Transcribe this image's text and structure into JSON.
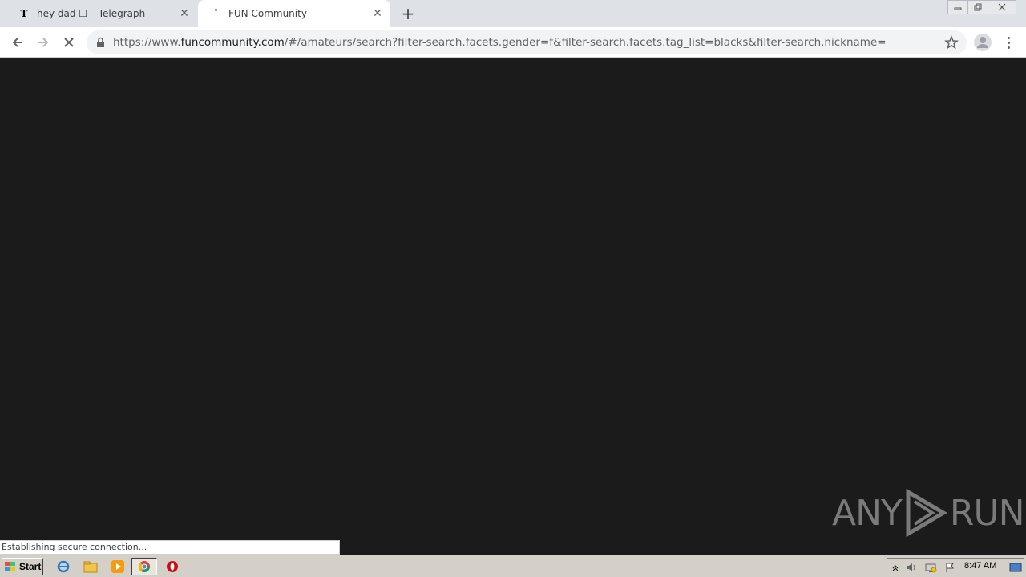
{
  "browser": {
    "tabs": [
      {
        "favicon": "T",
        "title": "hey dad ☐ – Telegraph",
        "close": "✕"
      },
      {
        "favicon": "loading-dot",
        "title": "FUN Community",
        "close": "✕"
      }
    ],
    "new_tab": "+",
    "url": {
      "scheme": "https://www.",
      "host": "funcommunity.com",
      "path": "/#/amateurs/search?filter-search.facets.gender=f&filter-search.facets.tag_list=blacks&filter-search.nickname="
    }
  },
  "status_bar": {
    "text": "Establishing secure connection..."
  },
  "watermark": {
    "left": "ANY",
    "right": "RUN"
  },
  "taskbar": {
    "start_label": "Start",
    "clock": "8:47 AM"
  },
  "colors": {
    "content_bg": "#1b1b1b",
    "tabstrip_bg": "#dee1e6",
    "taskbar_bg": "#d4d0c8"
  }
}
